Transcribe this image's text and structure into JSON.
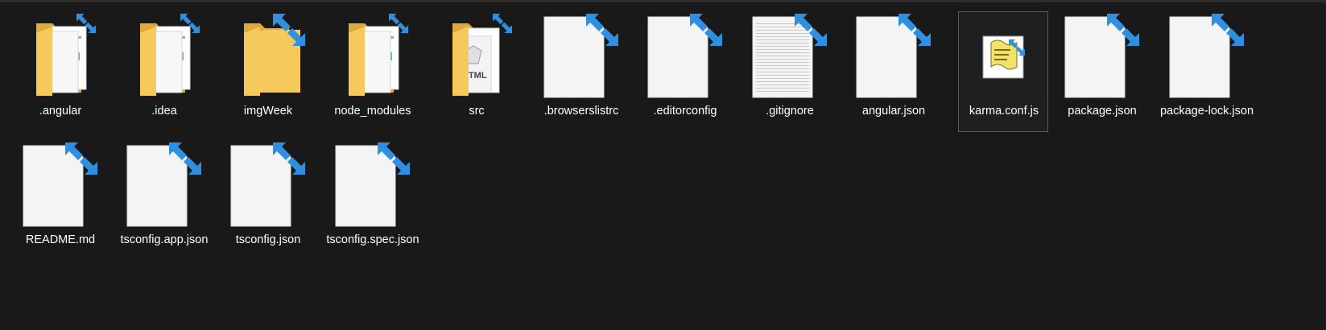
{
  "explorer": {
    "items": [
      {
        "name": ".angular",
        "kind": "folder-docs",
        "icon": "folder-icon"
      },
      {
        "name": ".idea",
        "kind": "folder-docs",
        "icon": "folder-icon"
      },
      {
        "name": "imgWeek",
        "kind": "folder-empty",
        "icon": "folder-icon"
      },
      {
        "name": "node_modules",
        "kind": "folder-docs",
        "icon": "folder-icon"
      },
      {
        "name": "src",
        "kind": "folder-html",
        "icon": "folder-icon"
      },
      {
        "name": ".browserslistrc",
        "kind": "file",
        "icon": "file-icon"
      },
      {
        "name": ".editorconfig",
        "kind": "file",
        "icon": "file-icon"
      },
      {
        "name": ".gitignore",
        "kind": "file-text",
        "icon": "text-file-icon"
      },
      {
        "name": "angular.json",
        "kind": "file",
        "icon": "file-icon"
      },
      {
        "name": "karma.conf.js",
        "kind": "script",
        "icon": "script-file-icon"
      },
      {
        "name": "package.json",
        "kind": "file",
        "icon": "file-icon"
      },
      {
        "name": "package-lock.json",
        "kind": "file",
        "icon": "file-icon"
      },
      {
        "name": "README.md",
        "kind": "file",
        "icon": "file-icon"
      },
      {
        "name": "tsconfig.app.json",
        "kind": "file",
        "icon": "file-icon"
      },
      {
        "name": "tsconfig.json",
        "kind": "file",
        "icon": "file-icon"
      },
      {
        "name": "tsconfig.spec.json",
        "kind": "file",
        "icon": "file-icon"
      }
    ],
    "selected_index": 9,
    "overlay_icon": "compressed-arrows-icon",
    "colors": {
      "background": "#191919",
      "folder": "#f5c95c",
      "folder_dark": "#e0a93a",
      "overlay": "#2f8fe0",
      "file": "#f4f4f4"
    }
  }
}
